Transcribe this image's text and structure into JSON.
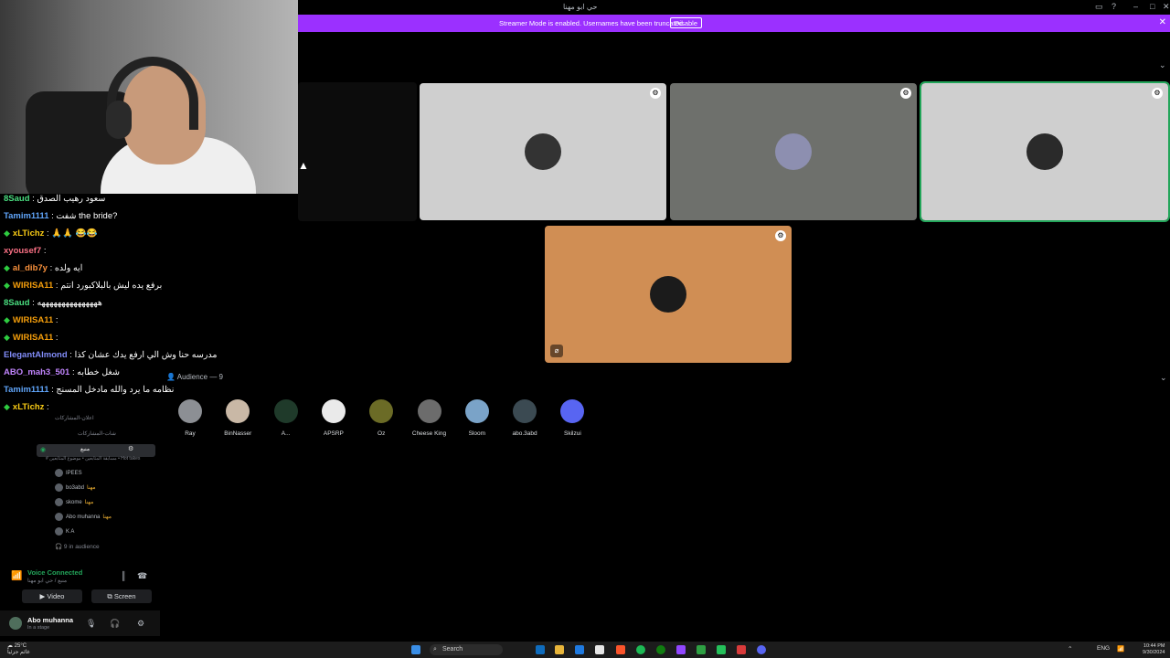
{
  "window": {
    "title": "حي ابو مهنا",
    "minimize": "–",
    "maximize": "□",
    "close": "✕"
  },
  "banner": {
    "message": "Streamer Mode is enabled. Usernames have been truncated.",
    "disable_label": "Disable"
  },
  "chat": [
    {
      "user": "8Saud",
      "sep": " : ",
      "msg": "سعود رهيب الصدق",
      "color": "#4ade80",
      "gem": false
    },
    {
      "user": "Tamim1111",
      "sep": " : ",
      "msg": "شفت the bride?",
      "color": "#60a5fa",
      "gem": false
    },
    {
      "user": "xLTichz",
      "sep": " : ",
      "msg": "🙏🙏 😂😂",
      "color": "#facc15",
      "gem": true
    },
    {
      "user": "xyousef7",
      "sep": " : ",
      "msg": "",
      "color": "#fb7185",
      "gem": false
    },
    {
      "user": "al_dib7y",
      "sep": " : ",
      "msg": "ايه ولده",
      "color": "#fb923c",
      "gem": true
    },
    {
      "user": "WIRISA11",
      "sep": " : ",
      "msg": "برفع يده ليش بالبلاكبورد انتم",
      "color": "#f59e0b",
      "gem": true
    },
    {
      "user": "8Saud",
      "sep": " : ",
      "msg": "هههههههههههههههه",
      "color": "#4ade80",
      "gem": false
    },
    {
      "user": "WIRISA11",
      "sep": " : ",
      "msg": "",
      "color": "#f59e0b",
      "gem": true
    },
    {
      "user": "WIRISA11",
      "sep": " : ",
      "msg": "",
      "color": "#f59e0b",
      "gem": true
    },
    {
      "user": "ElegantAlmond",
      "sep": " : ",
      "msg": "مدرسه حنا وش الي ارفع يدك عشان كذا",
      "color": "#818cf8",
      "gem": false
    },
    {
      "user": "ABO_mah3_501",
      "sep": " : ",
      "msg": "شغل خطابه",
      "color": "#c084fc",
      "gem": false
    },
    {
      "user": "Tamim1111",
      "sep": " : ",
      "msg": "نظامه ما يرد والله مادخل المسنج",
      "color": "#60a5fa",
      "gem": false
    },
    {
      "user": "xLTichz",
      "sep": " : ",
      "msg": "",
      "color": "#facc15",
      "gem": true
    }
  ],
  "channels": {
    "rows": [
      "اعلان-المشاركات",
      "شات-المشاركات"
    ],
    "stage_name": "منبع",
    "stage_sub": "# مسابقة المتابعين • موضوع المتابعين • Hot takes",
    "members": [
      {
        "name": "IPEES",
        "badge": ""
      },
      {
        "name": "bo3abd",
        "badge": "مهنا"
      },
      {
        "name": "skome",
        "badge": "مهنا"
      },
      {
        "name": "Abo muhanna",
        "badge": "مهنا"
      },
      {
        "name": "K A",
        "badge": ""
      }
    ],
    "audience": "9 in audience"
  },
  "voice": {
    "status": "Voice Connected",
    "channel": "منبع / حي ابو مهنا",
    "video_label": "Video",
    "screen_label": "Screen"
  },
  "user": {
    "name": "Abo muhanna",
    "status": "In a stage"
  },
  "stage": {
    "audience_header": "Audience — 9",
    "speakers": [
      {
        "bg": "#cfcfcf",
        "avatar": "#333"
      },
      {
        "bg": "#6e706c",
        "avatar": "#8d8fb0"
      },
      {
        "bg": "#cfcfcf",
        "avatar": "#2a2a2a"
      },
      {
        "bg": "#d08e54",
        "avatar": "#1b1b1b"
      }
    ],
    "audience": [
      {
        "name": "Ray",
        "color": "#8c8f94"
      },
      {
        "name": "BinNasser",
        "color": "#c9b8a6"
      },
      {
        "name": "A...",
        "color": "#1f3a2a"
      },
      {
        "name": "APSRP",
        "color": "#eaeaea"
      },
      {
        "name": "Oz",
        "color": "#6b6b26"
      },
      {
        "name": "Cheese King",
        "color": "#6c6c6c"
      },
      {
        "name": "Sloom",
        "color": "#7aa3c8"
      },
      {
        "name": "abo.3abd",
        "color": "#3b4a52"
      },
      {
        "name": "Skilzui",
        "color": "#5865f2"
      }
    ]
  },
  "taskbar": {
    "temp": "25°C",
    "weather": "غائم جزئياً",
    "search": "Search",
    "lang": "ENG",
    "time": "10:44 PM",
    "date": "9/30/2024"
  }
}
